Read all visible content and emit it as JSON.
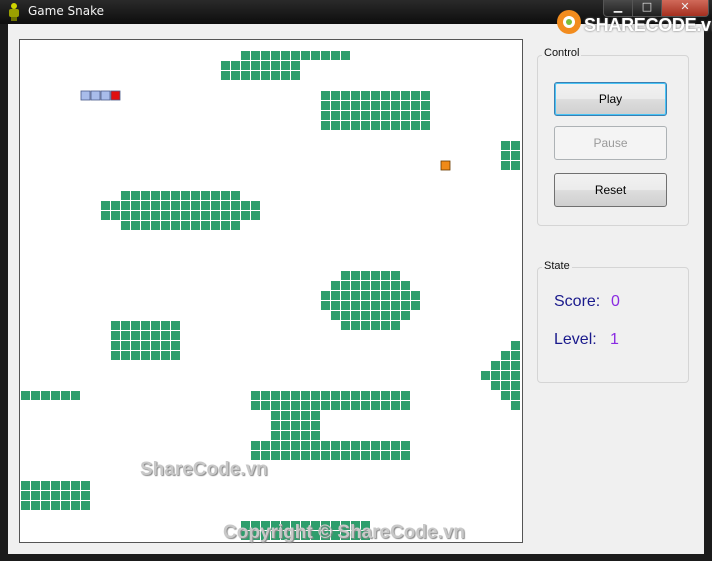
{
  "window": {
    "title": "Game Snake",
    "minimize_glyph": "▁",
    "maximize_glyph": "□",
    "close_glyph": "✕"
  },
  "watermark": {
    "logo_text": "SHARECODE.vn",
    "middle_text": "ShareCode.vn",
    "copyright_text": "Copyright © ShareCode.vn"
  },
  "control": {
    "caption": "Control",
    "play_label": "Play",
    "pause_label": "Pause",
    "reset_label": "Reset"
  },
  "state": {
    "caption": "State",
    "score_label": "Score:",
    "score_value": "0",
    "level_label": "Level:",
    "level_value": "1"
  },
  "colors": {
    "wall": "#2e9e6c",
    "snake_body": "#a9bcea",
    "snake_head": "#e01010",
    "food": "#f08a18",
    "label": "#1a1a8c",
    "value": "#8a2be2"
  },
  "board": {
    "grid_cols": 50,
    "grid_rows": 50,
    "snake": [
      [
        6,
        5
      ],
      [
        7,
        5
      ],
      [
        8,
        5
      ],
      [
        9,
        5
      ]
    ],
    "food": [
      42,
      12
    ],
    "walls": [
      [
        22,
        1,
        11,
        1
      ],
      [
        20,
        2,
        8,
        2
      ],
      [
        30,
        5,
        11,
        4
      ],
      [
        48,
        10,
        2,
        3
      ],
      [
        10,
        15,
        7,
        4
      ],
      [
        16,
        15,
        6,
        4
      ],
      [
        8,
        16,
        7,
        2
      ],
      [
        16,
        16,
        8,
        2
      ],
      [
        32,
        23,
        6,
        1
      ],
      [
        31,
        24,
        8,
        1
      ],
      [
        30,
        25,
        10,
        2
      ],
      [
        31,
        27,
        8,
        1
      ],
      [
        32,
        28,
        6,
        1
      ],
      [
        9,
        28,
        7,
        4
      ],
      [
        49,
        30,
        1,
        1
      ],
      [
        48,
        31,
        2,
        1
      ],
      [
        47,
        32,
        3,
        1
      ],
      [
        46,
        33,
        4,
        1
      ],
      [
        47,
        34,
        3,
        1
      ],
      [
        48,
        35,
        2,
        1
      ],
      [
        49,
        36,
        1,
        1
      ],
      [
        0,
        35,
        6,
        1
      ],
      [
        23,
        35,
        16,
        2
      ],
      [
        25,
        37,
        5,
        3
      ],
      [
        23,
        40,
        16,
        2
      ],
      [
        0,
        44,
        7,
        3
      ],
      [
        22,
        48,
        13,
        2
      ]
    ]
  }
}
